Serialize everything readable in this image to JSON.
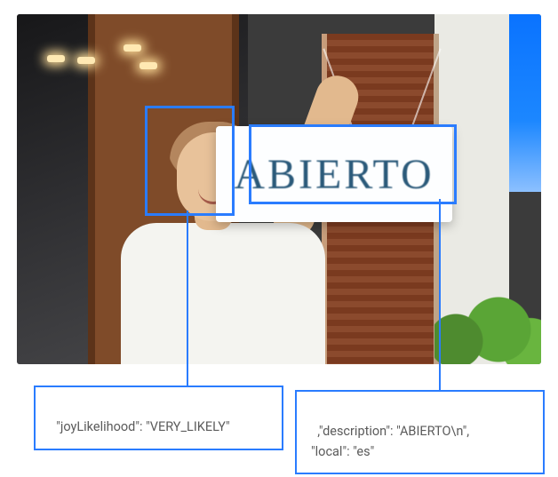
{
  "image": {
    "sign_text": "ABIERTO"
  },
  "detections": {
    "face": {
      "box": "face-bounding-box",
      "callout_text": "\"joyLikelihood\": \"VERY_LIKELY\""
    },
    "text": {
      "box": "text-bounding-box",
      "callout_text": ",\"description\": \"ABIERTO\\n\",\n\"local\": \"es\""
    }
  },
  "colors": {
    "annotation_blue": "#2a7cff"
  }
}
